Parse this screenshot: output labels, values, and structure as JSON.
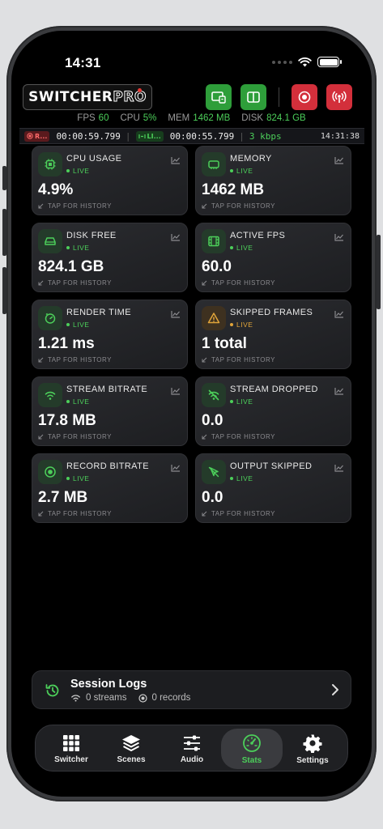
{
  "status": {
    "time": "14:31"
  },
  "header": {
    "logo_text": "SWITCHER",
    "logo_pro": "PRO"
  },
  "metrics": [
    {
      "key": "FPS",
      "value": "60"
    },
    {
      "key": "CPU",
      "value": "5%"
    },
    {
      "key": "MEM",
      "value": "1462 MB"
    },
    {
      "key": "DISK",
      "value": "824.1 GB"
    }
  ],
  "timers": {
    "rec_badge": "R...",
    "rec_time": "00:00:59.799",
    "live_badge": "LI...",
    "live_time": "00:00:55.799",
    "bitrate": "3 kbps",
    "clock": "14:31:38"
  },
  "cards": [
    {
      "title": "CPU USAGE",
      "status": "LIVE",
      "value": "4.9%",
      "hint": "TAP FOR HISTORY",
      "icon": "cpu-icon"
    },
    {
      "title": "MEMORY",
      "status": "LIVE",
      "value": "1462 MB",
      "hint": "TAP FOR HISTORY",
      "icon": "memory-icon"
    },
    {
      "title": "DISK FREE",
      "status": "LIVE",
      "value": "824.1 GB",
      "hint": "TAP FOR HISTORY",
      "icon": "disk-icon"
    },
    {
      "title": "ACTIVE FPS",
      "status": "LIVE",
      "value": "60.0",
      "hint": "TAP FOR HISTORY",
      "icon": "film-icon"
    },
    {
      "title": "RENDER TIME",
      "status": "LIVE",
      "value": "1.21 ms",
      "hint": "TAP FOR HISTORY",
      "icon": "timer-icon"
    },
    {
      "title": "SKIPPED FRAMES",
      "status": "LIVE",
      "value": "1 total",
      "hint": "TAP FOR HISTORY",
      "icon": "warning-icon"
    },
    {
      "title": "STREAM BITRATE",
      "status": "LIVE",
      "value": "17.8 MB",
      "hint": "TAP FOR HISTORY",
      "icon": "wifi-icon"
    },
    {
      "title": "STREAM DROPPED",
      "status": "LIVE",
      "value": "0.0",
      "hint": "TAP FOR HISTORY",
      "icon": "wifi-off-icon"
    },
    {
      "title": "RECORD BITRATE",
      "status": "LIVE",
      "value": "2.7 MB",
      "hint": "TAP FOR HISTORY",
      "icon": "record-icon"
    },
    {
      "title": "OUTPUT SKIPPED",
      "status": "LIVE",
      "value": "0.0",
      "hint": "TAP FOR HISTORY",
      "icon": "cursor-off-icon"
    }
  ],
  "session_logs": {
    "title": "Session Logs",
    "streams": "0 streams",
    "records": "0 records"
  },
  "tabs": [
    {
      "label": "Switcher",
      "icon": "grid-icon"
    },
    {
      "label": "Scenes",
      "icon": "layers-icon"
    },
    {
      "label": "Audio",
      "icon": "sliders-icon"
    },
    {
      "label": "Stats",
      "icon": "gauge-icon"
    },
    {
      "label": "Settings",
      "icon": "gear-icon"
    }
  ],
  "colors": {
    "accent": "#4ccf5a",
    "warning": "#e0a43a",
    "danger": "#d32f3b"
  }
}
